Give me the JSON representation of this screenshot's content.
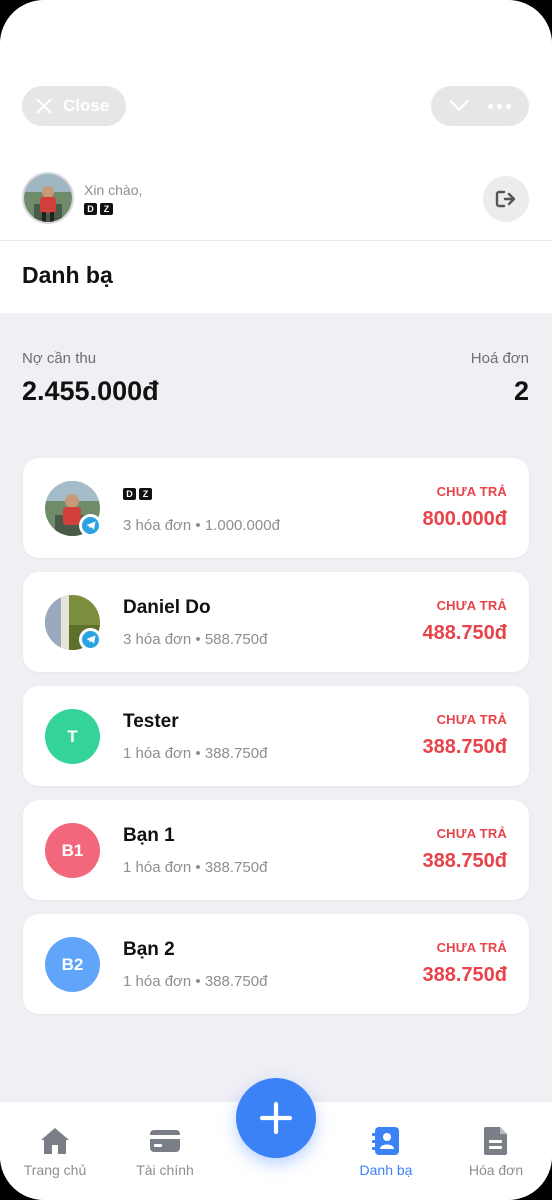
{
  "top_bar": {
    "close_label": "Close",
    "chevron_icon": "chevron-down-icon",
    "more_icon": "more-dots-icon"
  },
  "user": {
    "greeting": "Xin chào,",
    "name_badge": [
      "D",
      "Z"
    ],
    "logout_icon": "logout-icon"
  },
  "page": {
    "title": "Danh bạ"
  },
  "summary": {
    "debt_label": "Nợ cần thu",
    "debt_value": "2.455.000đ",
    "invoice_label": "Hoá đơn",
    "invoice_value": "2"
  },
  "contacts": [
    {
      "name": "",
      "badge": [
        "D",
        "Z"
      ],
      "invoices": "3 hóa đơn",
      "total": "1.000.000đ",
      "status": "CHƯA TRẢ",
      "amount": "800.000đ",
      "avatar": "photo",
      "telegram": true
    },
    {
      "name": "Daniel Do",
      "invoices": "3 hóa đơn",
      "total": "588.750đ",
      "status": "CHƯA TRẢ",
      "amount": "488.750đ",
      "avatar": "photo",
      "telegram": true
    },
    {
      "name": "Tester",
      "invoices": "1 hóa đơn",
      "total": "388.750đ",
      "status": "CHƯA TRẢ",
      "amount": "388.750đ",
      "initials": "T",
      "color": "#34d399"
    },
    {
      "name": "Bạn 1",
      "invoices": "1 hóa đơn",
      "total": "388.750đ",
      "status": "CHƯA TRẢ",
      "amount": "388.750đ",
      "initials": "B1",
      "color": "#f3677c"
    },
    {
      "name": "Bạn 2",
      "invoices": "1 hóa đơn",
      "total": "388.750đ",
      "status": "CHƯA TRẢ",
      "amount": "388.750đ",
      "initials": "B2",
      "color": "#60a5fa"
    }
  ],
  "separator": "•",
  "tabs": [
    {
      "label": "Trang chủ",
      "icon": "home-icon"
    },
    {
      "label": "Tài chính",
      "icon": "card-icon"
    },
    {
      "label": "Danh bạ",
      "icon": "contacts-icon",
      "active": true
    },
    {
      "label": "Hóa đơn",
      "icon": "invoice-icon"
    }
  ],
  "fab_icon": "plus-icon",
  "colors": {
    "accent": "#3b82f6",
    "danger": "#e8434a",
    "muted": "#8e8e93"
  }
}
